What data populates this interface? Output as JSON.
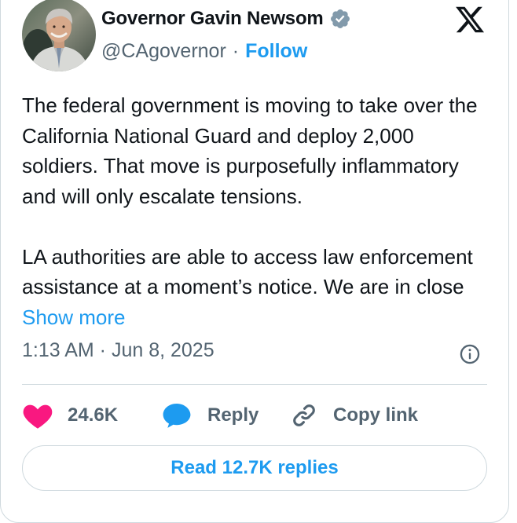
{
  "author": {
    "display_name": "Governor Gavin Newsom",
    "handle": "@CAgovernor",
    "separator": "·",
    "follow_label": "Follow",
    "verified": true
  },
  "tweet": {
    "paragraph_1": "The federal government is moving to take over the California National Guard and deploy 2,000 soldiers. That move is purposefully inflammatory and will only escalate tensions.",
    "paragraph_2": "LA authorities are able to access law enforcement assistance at a moment’s notice. We are in close ",
    "show_more_label": "Show more",
    "timestamp": "1:13 AM · Jun 8, 2025"
  },
  "actions": {
    "like_count": "24.6K",
    "reply_label": "Reply",
    "copy_link_label": "Copy link",
    "read_replies_label": "Read 12.7K replies"
  },
  "icons": {
    "platform_logo": "x-logo-icon",
    "verified": "verified-badge-icon",
    "info": "info-icon",
    "like": "heart-icon",
    "reply": "speech-bubble-icon",
    "copy_link": "link-icon"
  },
  "colors": {
    "accent": "#1d9bf0",
    "like": "#f91880",
    "verified_badge": "#829aab",
    "text_primary": "#0f1419",
    "text_secondary": "#536471",
    "border": "#cfd9de"
  }
}
